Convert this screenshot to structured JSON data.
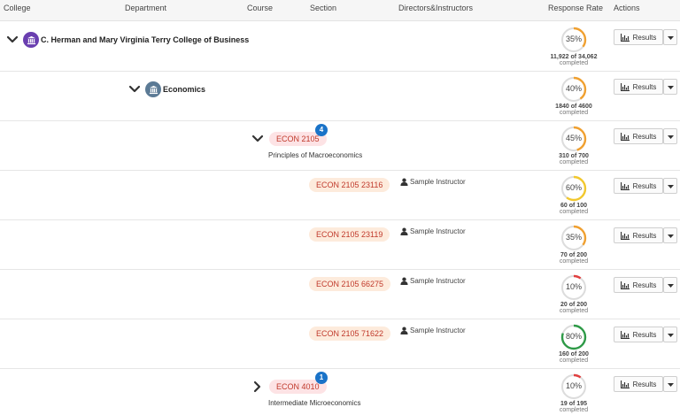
{
  "header": {
    "college": "College",
    "department": "Department",
    "course": "Course",
    "section": "Section",
    "instructors": "Directors&Instructors",
    "response_rate": "Response Rate",
    "actions": "Actions"
  },
  "colors": {
    "orange_ring": "#f0a030",
    "yellow_ring": "#f2c82e",
    "red_ring": "#e04040",
    "green_ring": "#2e9a47",
    "ring_track": "#dcdcdc",
    "badge": "#1a73c8",
    "course_pill_bg": "#fde3e5",
    "section_pill_bg": "#fdebdc",
    "pill_text": "#c0392b"
  },
  "rows": [
    {
      "level": "college",
      "expanded": true,
      "name": "C. Herman and Mary Virginia Terry College of Business",
      "icon": "institution-icon",
      "rate_label": "35%",
      "rate": 0.35,
      "ring_color": "orange",
      "count": "11,922 of 34,062",
      "sub": "completed",
      "action": "Results"
    },
    {
      "level": "department",
      "expanded": true,
      "name": "Economics",
      "icon": "institution-icon",
      "rate_label": "40%",
      "rate": 0.4,
      "ring_color": "orange",
      "count": "1840 of 4600",
      "sub": "completed",
      "action": "Results"
    },
    {
      "level": "course",
      "expanded": true,
      "code": "ECON 2105",
      "badge": "4",
      "title": "Principles of Macroeconomics",
      "rate_label": "45%",
      "rate": 0.45,
      "ring_color": "orange",
      "count": "310 of 700",
      "sub": "completed",
      "action": "Results"
    },
    {
      "level": "section",
      "code": "ECON 2105 23116",
      "instructor": "Sample Instructor",
      "rate_label": "60%",
      "rate": 0.6,
      "ring_color": "yellow",
      "count": "60 of 100",
      "sub": "completed",
      "action": "Results"
    },
    {
      "level": "section",
      "code": "ECON 2105 23119",
      "instructor": "Sample Instructor",
      "rate_label": "35%",
      "rate": 0.35,
      "ring_color": "orange",
      "count": "70 of 200",
      "sub": "completed",
      "action": "Results"
    },
    {
      "level": "section",
      "code": "ECON 2105 66275",
      "instructor": "Sample Instructor",
      "rate_label": "10%",
      "rate": 0.1,
      "ring_color": "red",
      "count": "20 of 200",
      "sub": "completed",
      "action": "Results"
    },
    {
      "level": "section",
      "code": "ECON 2105 71622",
      "instructor": "Sample Instructor",
      "rate_label": "80%",
      "rate": 0.8,
      "ring_color": "green",
      "count": "160 of 200",
      "sub": "completed",
      "action": "Results"
    },
    {
      "level": "course",
      "expanded": false,
      "code": "ECON 4010",
      "badge": "1",
      "title": "Intermediate Microeconomics",
      "rate_label": "10%",
      "rate": 0.1,
      "ring_color": "red",
      "count": "19 of 195",
      "sub": "completed",
      "action": "Results"
    }
  ]
}
